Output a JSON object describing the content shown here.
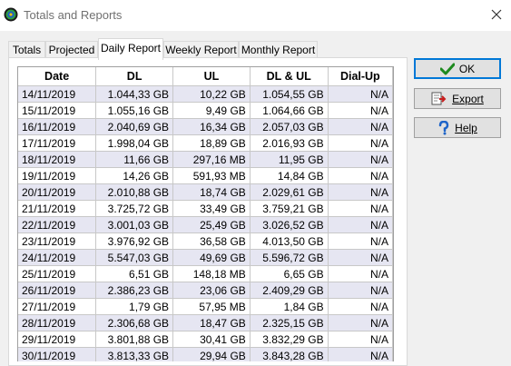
{
  "window": {
    "title": "Totals and Reports"
  },
  "tabs": [
    {
      "label": "Totals"
    },
    {
      "label": "Projected"
    },
    {
      "label": "Daily Report"
    },
    {
      "label": "Weekly Report"
    },
    {
      "label": "Monthly Report"
    }
  ],
  "active_tab": "Daily Report",
  "table": {
    "columns": [
      "Date",
      "DL",
      "UL",
      "DL & UL",
      "Dial-Up"
    ],
    "rows": [
      [
        "14/11/2019",
        "1.044,33 GB",
        "10,22 GB",
        "1.054,55 GB",
        "N/A"
      ],
      [
        "15/11/2019",
        "1.055,16 GB",
        "9,49 GB",
        "1.064,66 GB",
        "N/A"
      ],
      [
        "16/11/2019",
        "2.040,69 GB",
        "16,34 GB",
        "2.057,03 GB",
        "N/A"
      ],
      [
        "17/11/2019",
        "1.998,04 GB",
        "18,89 GB",
        "2.016,93 GB",
        "N/A"
      ],
      [
        "18/11/2019",
        "11,66 GB",
        "297,16 MB",
        "11,95 GB",
        "N/A"
      ],
      [
        "19/11/2019",
        "14,26 GB",
        "591,93 MB",
        "14,84 GB",
        "N/A"
      ],
      [
        "20/11/2019",
        "2.010,88 GB",
        "18,74 GB",
        "2.029,61 GB",
        "N/A"
      ],
      [
        "21/11/2019",
        "3.725,72 GB",
        "33,49 GB",
        "3.759,21 GB",
        "N/A"
      ],
      [
        "22/11/2019",
        "3.001,03 GB",
        "25,49 GB",
        "3.026,52 GB",
        "N/A"
      ],
      [
        "23/11/2019",
        "3.976,92 GB",
        "36,58 GB",
        "4.013,50 GB",
        "N/A"
      ],
      [
        "24/11/2019",
        "5.547,03 GB",
        "49,69 GB",
        "5.596,72 GB",
        "N/A"
      ],
      [
        "25/11/2019",
        "6,51 GB",
        "148,18 MB",
        "6,65 GB",
        "N/A"
      ],
      [
        "26/11/2019",
        "2.386,23 GB",
        "23,06 GB",
        "2.409,29 GB",
        "N/A"
      ],
      [
        "27/11/2019",
        "1,79 GB",
        "57,95 MB",
        "1,84 GB",
        "N/A"
      ],
      [
        "28/11/2019",
        "2.306,68 GB",
        "18,47 GB",
        "2.325,15 GB",
        "N/A"
      ],
      [
        "29/11/2019",
        "3.801,88 GB",
        "30,41 GB",
        "3.832,29 GB",
        "N/A"
      ],
      [
        "30/11/2019",
        "3.813,33 GB",
        "29,94 GB",
        "3.843,28 GB",
        "N/A"
      ]
    ]
  },
  "buttons": {
    "ok": "OK",
    "export": "Export",
    "help": "Help"
  },
  "colors": {
    "row_alt": "#e6e6f2",
    "default_button_border": "#0078d7",
    "ok_check": "#1e8a1e",
    "help_icon": "#1e64c8"
  },
  "icons": {
    "app": "app-icon",
    "close": "close-icon",
    "ok": "check-icon",
    "export": "export-icon",
    "help": "help-icon",
    "scroll_up": "scroll-up-arrow-icon"
  }
}
